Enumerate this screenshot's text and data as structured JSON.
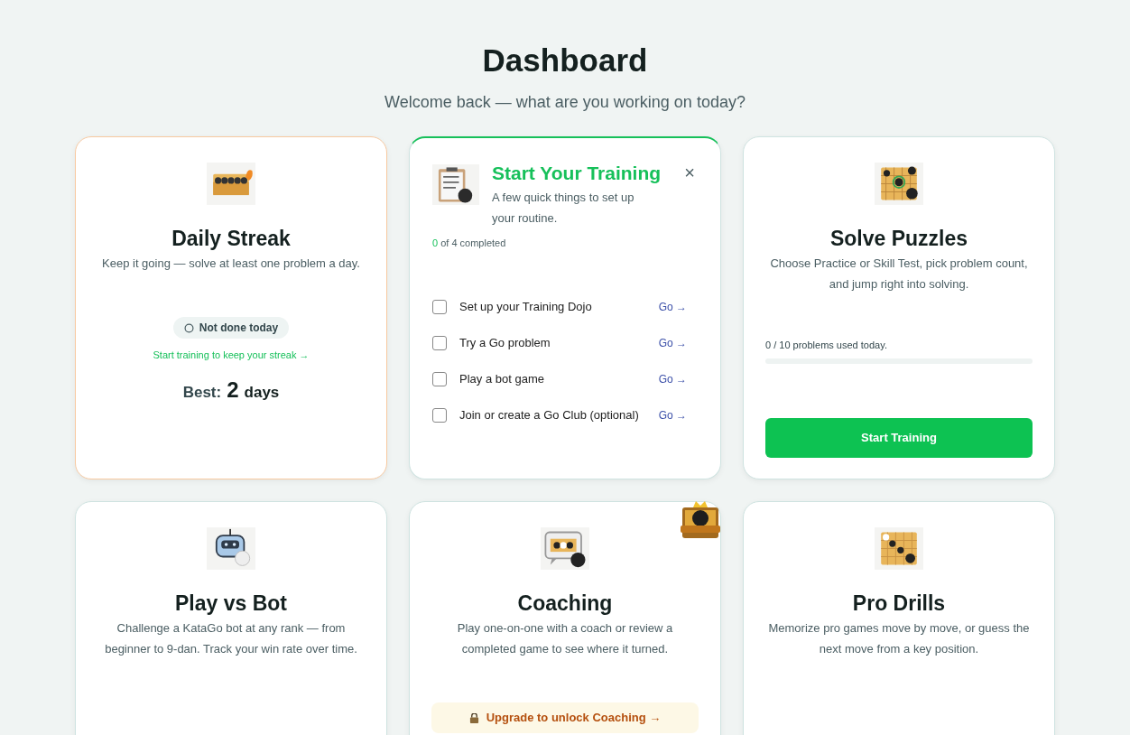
{
  "header": {
    "title": "Dashboard",
    "subtitle": "Welcome back — what are you working on today?"
  },
  "cards": [
    {
      "kind": "streak",
      "title": "Daily Streak",
      "description": "Keep it going — solve at least one problem a day.",
      "status": {
        "label": "Not done today",
        "done": false
      },
      "link": "Start training to keep your streak →",
      "best": {
        "label": "Best:",
        "value": "2",
        "unit": "days"
      }
    },
    {
      "kind": "checklist",
      "title": "Start Your Training",
      "subtitle": "A few quick things to set up your routine.",
      "close": "×",
      "progress_count": "0",
      "progress_text": "of 4 completed",
      "items": [
        {
          "label": "Set up your Training Dojo",
          "checked": false,
          "action": "Go →"
        },
        {
          "label": "Try a Go problem",
          "checked": false,
          "action": "Go →"
        },
        {
          "label": "Play a bot game",
          "checked": false,
          "action": "Go →"
        },
        {
          "label": "Join or create a Go Club (optional)",
          "checked": false,
          "action": "Go →"
        }
      ]
    },
    {
      "kind": "puzzles",
      "title": "Solve Puzzles",
      "description": "Choose Practice or Skill Test, pick problem count, and jump right into solving.",
      "usage": "0 / 10 problems used today.",
      "level": 0,
      "button": "Start Training"
    },
    {
      "kind": "bot",
      "title": "Play vs Bot",
      "description": "Challenge a KataGo bot at any rank — from beginner to 9-dan. Track your win rate over time."
    },
    {
      "kind": "coaching",
      "title": "Coaching",
      "description": "Play one-on-one with a coach or review a completed game to see where it turned.",
      "premium": true,
      "upgrade": "Upgrade to unlock Coaching →"
    },
    {
      "kind": "drills",
      "title": "Pro Drills",
      "description": "Memorize pro games move by move, or guess the next move from a key position."
    }
  ]
}
